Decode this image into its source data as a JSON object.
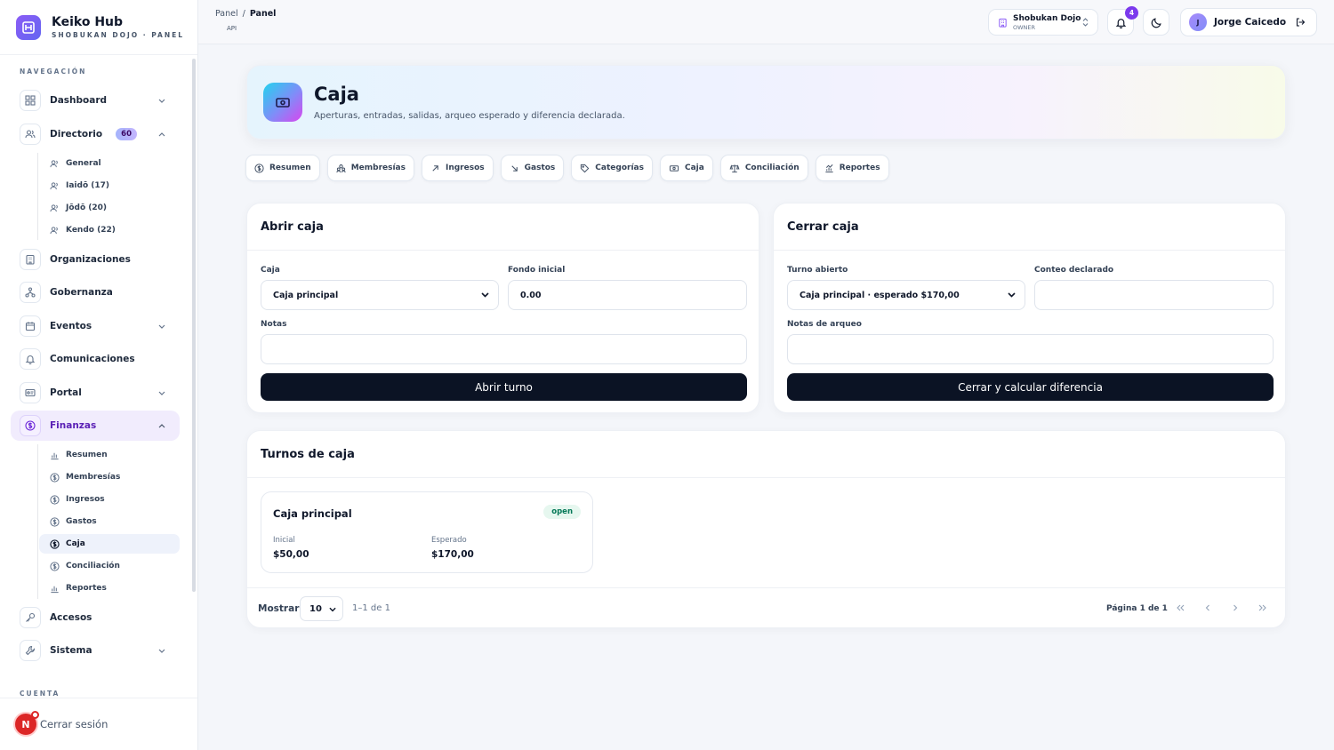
{
  "brand": {
    "title": "Keiko Hub",
    "subtitle": "SHOBUKAN DOJO · PANEL"
  },
  "nav": {
    "section_label": "NAVEGACIÓN",
    "account_label": "CUENTA",
    "items": [
      {
        "label": "Dashboard"
      },
      {
        "label": "Directorio",
        "badge": "60"
      },
      {
        "label": "Organizaciones"
      },
      {
        "label": "Gobernanza"
      },
      {
        "label": "Eventos"
      },
      {
        "label": "Comunicaciones"
      },
      {
        "label": "Portal"
      },
      {
        "label": "Finanzas"
      },
      {
        "label": "Accesos"
      },
      {
        "label": "Sistema"
      }
    ],
    "directorio_sub": [
      {
        "label": "General"
      },
      {
        "label": "Iaidō (17)"
      },
      {
        "label": "Jōdō (20)"
      },
      {
        "label": "Kendo (22)"
      }
    ],
    "finanzas_sub": [
      {
        "label": "Resumen"
      },
      {
        "label": "Membresías"
      },
      {
        "label": "Ingresos"
      },
      {
        "label": "Gastos"
      },
      {
        "label": "Caja"
      },
      {
        "label": "Conciliación"
      },
      {
        "label": "Reportes"
      }
    ],
    "logout_label": "Cerrar sesión",
    "avatar_initial": "N"
  },
  "topbar": {
    "crumb_root": "Panel",
    "crumb_sep": "/",
    "crumb_current": "Panel",
    "api_tag": "API",
    "org_name": "Shobukan Dojo",
    "org_role": "OWNER",
    "notif_count": "4",
    "user_initial": "J",
    "user_name": "Jorge Caicedo"
  },
  "hero": {
    "title": "Caja",
    "subtitle": "Aperturas, entradas, salidas, arqueo esperado y diferencia declarada."
  },
  "tabs": [
    {
      "label": "Resumen"
    },
    {
      "label": "Membresías"
    },
    {
      "label": "Ingresos"
    },
    {
      "label": "Gastos"
    },
    {
      "label": "Categorías"
    },
    {
      "label": "Caja"
    },
    {
      "label": "Conciliación"
    },
    {
      "label": "Reportes"
    }
  ],
  "open_form": {
    "title": "Abrir caja",
    "caja_label": "Caja",
    "caja_value": "Caja principal",
    "fondo_label": "Fondo inicial",
    "fondo_value": "0.00",
    "notas_label": "Notas",
    "notas_value": "",
    "button": "Abrir turno"
  },
  "close_form": {
    "title": "Cerrar caja",
    "turno_label": "Turno abierto",
    "turno_value": "Caja principal · esperado $170,00",
    "conteo_label": "Conteo declarado",
    "conteo_value": "",
    "notas_label": "Notas de arqueo",
    "notas_value": "",
    "button": "Cerrar y calcular diferencia"
  },
  "shifts": {
    "title": "Turnos de caja",
    "items": [
      {
        "name": "Caja principal",
        "status": "open",
        "inicial_label": "Inicial",
        "inicial": "$50,00",
        "esperado_label": "Esperado",
        "esperado": "$170,00"
      }
    ],
    "mostrar_label": "Mostrar",
    "page_size": "10",
    "range": "1–1 de 1",
    "page_info": "Página 1 de 1"
  }
}
